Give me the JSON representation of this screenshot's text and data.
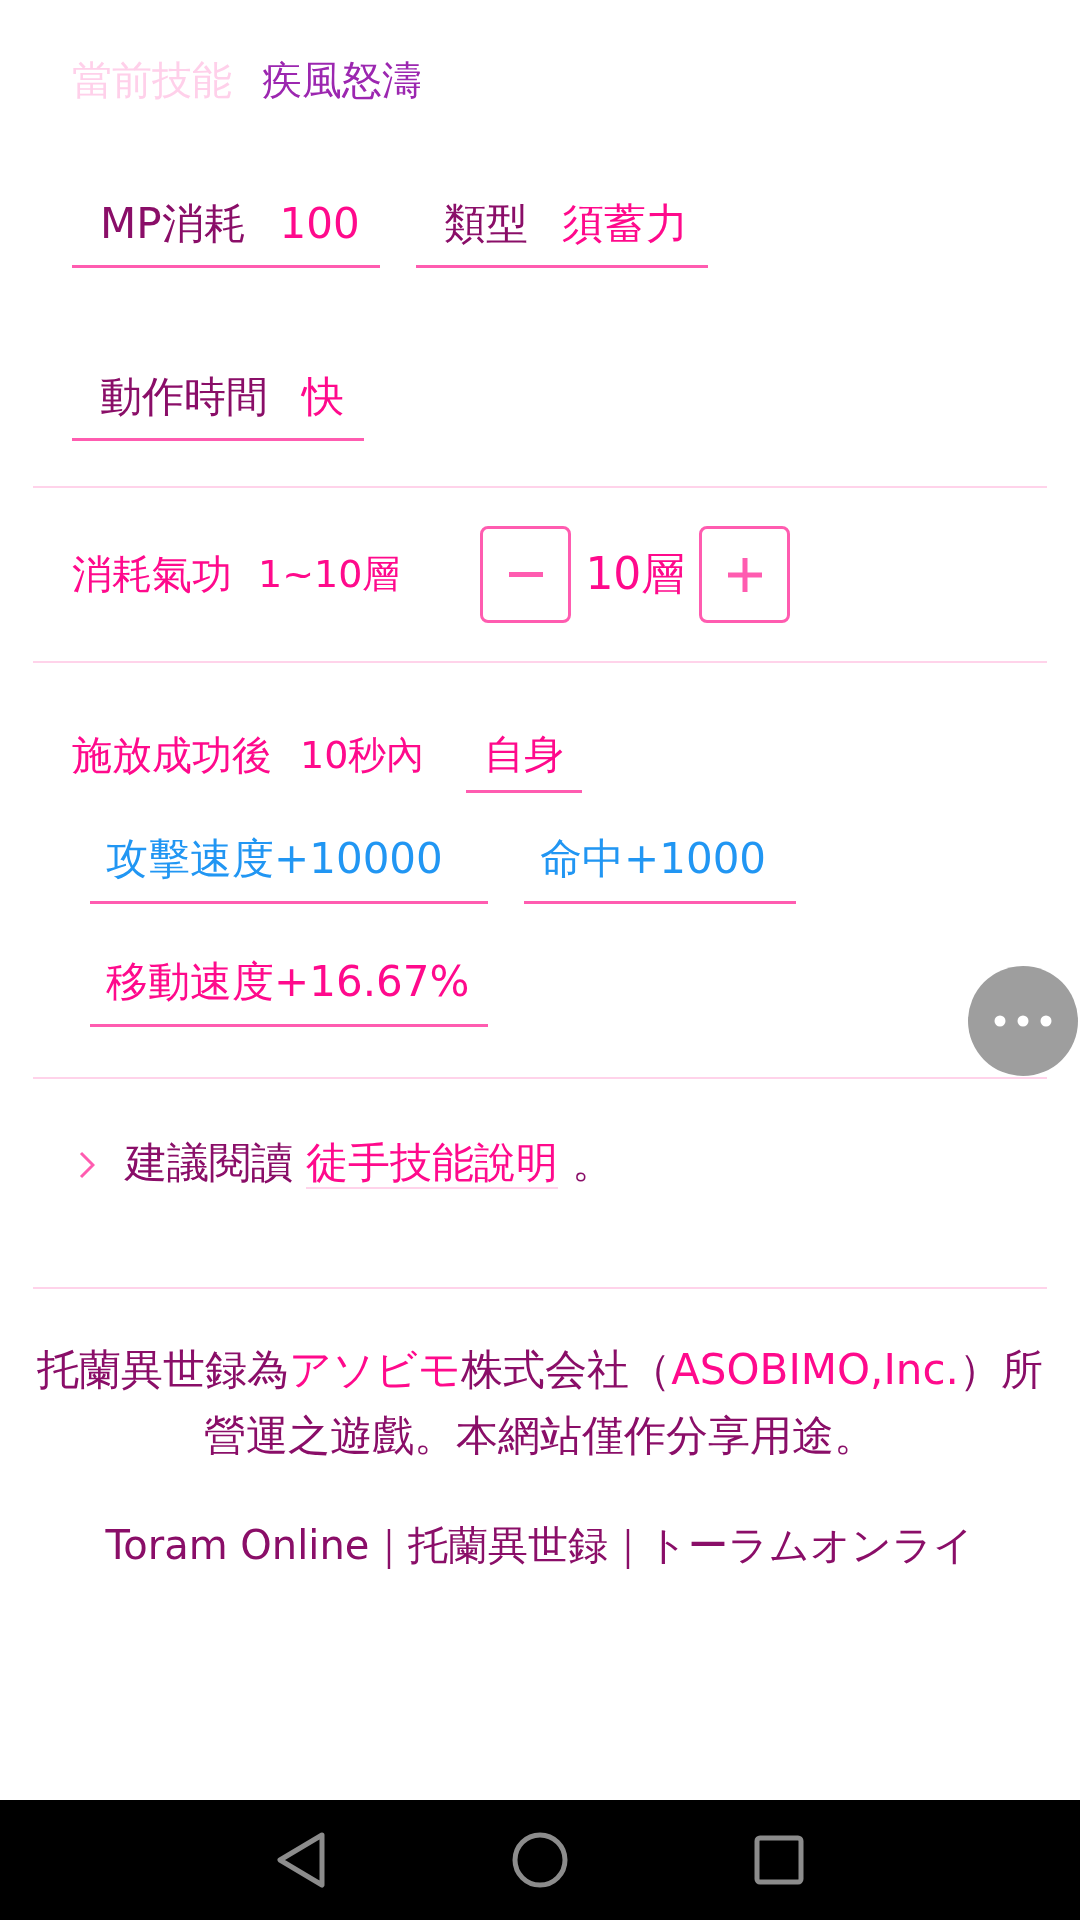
{
  "current_skill": {
    "label": "當前技能",
    "value": "疾風怒濤"
  },
  "stats": [
    {
      "label": "MP消耗",
      "value": "100"
    },
    {
      "label": "類型",
      "value": "須蓄力"
    },
    {
      "label": "動作時間",
      "value": "快"
    }
  ],
  "stack": {
    "label": "消耗氣功",
    "range": "1~10層",
    "value": "10層"
  },
  "effect": {
    "trigger": "施放成功後",
    "duration": "10秒內",
    "target": "自身",
    "buffs": [
      {
        "text": "攻擊速度+10000",
        "color": "#2196f3"
      },
      {
        "text": "命中+1000",
        "color": "#2196f3"
      },
      {
        "text": "移動速度+16.67%",
        "color": "#ff0a8c"
      }
    ]
  },
  "suggestion": {
    "text": "建議閱讀",
    "link": "徒手技能說明",
    "end": "。"
  },
  "footer": {
    "notice": "托蘭異世録為**アソビモ**株式会社（**ASOBIMO,Inc.**）所營運之遊戲。本網站僅作分享用途。",
    "titles": "**Toram Online**｜托蘭異世録｜**トーラムオンライ**"
  }
}
